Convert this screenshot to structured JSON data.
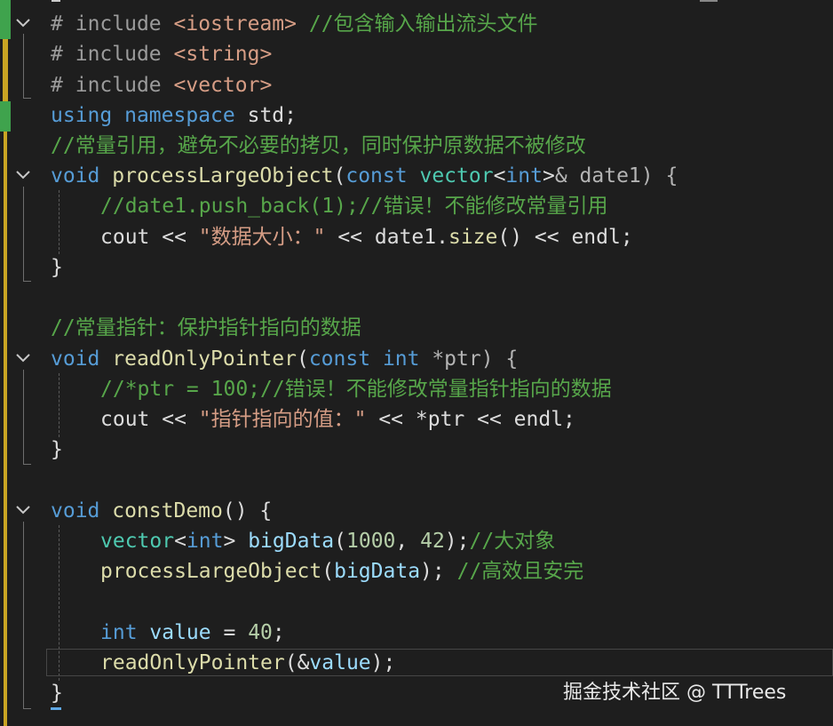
{
  "colors": {
    "background": "#1e1e1e",
    "keyword": "#569cd6",
    "type": "#4ec9b0",
    "function": "#dcdcaa",
    "string": "#d69d85",
    "comment": "#57a64a",
    "number": "#b5cea8",
    "change_saved": "#3fa34d",
    "change_unsaved": "#c9a423"
  },
  "code": {
    "l1": {
      "hash": "#",
      "kw": "include",
      "header": "<iostream>",
      "comment": "//包含输入输出流头文件"
    },
    "l2": {
      "hash": "#",
      "kw": "include",
      "header": "<string>"
    },
    "l3": {
      "hash": "#",
      "kw": "include",
      "header": "<vector>"
    },
    "l4": {
      "kw1": "using",
      "kw2": "namespace",
      "ns": "std;"
    },
    "l5": {
      "comment": "//常量引用，避免不必要的拷贝，同时保护原数据不被修改"
    },
    "l6": {
      "ret": "void",
      "name": "processLargeObject",
      "p1": "(",
      "kw_const": "const",
      "type": "vector",
      "lt": "<",
      "tint": "int",
      "gt": ">",
      "rest": "& date1) {"
    },
    "l7": {
      "comment": "//date1.push_back(1);//错误！不能修改常量引用"
    },
    "l8": {
      "cout": "cout << ",
      "str": "\"数据大小：\"",
      "mid": " << date1.",
      "fn": "size",
      "end": "() << endl;"
    },
    "l9": {
      "brace": "}"
    },
    "l11": {
      "comment": "//常量指针：保护指针指向的数据"
    },
    "l12": {
      "ret": "void",
      "name": "readOnlyPointer",
      "p1": "(",
      "kw_const": "const",
      "kw_int": "int",
      "rest": " *ptr) {"
    },
    "l13": {
      "comment": "//*ptr = 100;//错误！不能修改常量指针指向的数据"
    },
    "l14": {
      "cout": "cout << ",
      "str": "\"指针指向的值：\"",
      "end": " << *ptr << endl;"
    },
    "l15": {
      "brace": "}"
    },
    "l17": {
      "ret": "void",
      "name": "constDemo",
      "end": "() {"
    },
    "l18": {
      "type": "vector",
      "lt": "<",
      "tint": "int",
      "gt": ">",
      "var": " bigData",
      "p1": "(",
      "n1": "1000",
      "comma": ", ",
      "n2": "42",
      "p2": ");",
      "comment": "//大对象"
    },
    "l19": {
      "fn": "processLargeObject",
      "p1": "(",
      "var": "bigData",
      "p2": "); ",
      "comment": "//高效且安完"
    },
    "l21": {
      "kw_int": "int",
      "var": " value",
      "eq": " = ",
      "num": "40",
      "semi": ";"
    },
    "l22": {
      "fn": "readOnlyPointer",
      "p1": "(&",
      "var": "value",
      "p2": ");"
    },
    "l23": {
      "brace": "}"
    }
  },
  "watermark": "掘金技术社区 @ TTTrees"
}
